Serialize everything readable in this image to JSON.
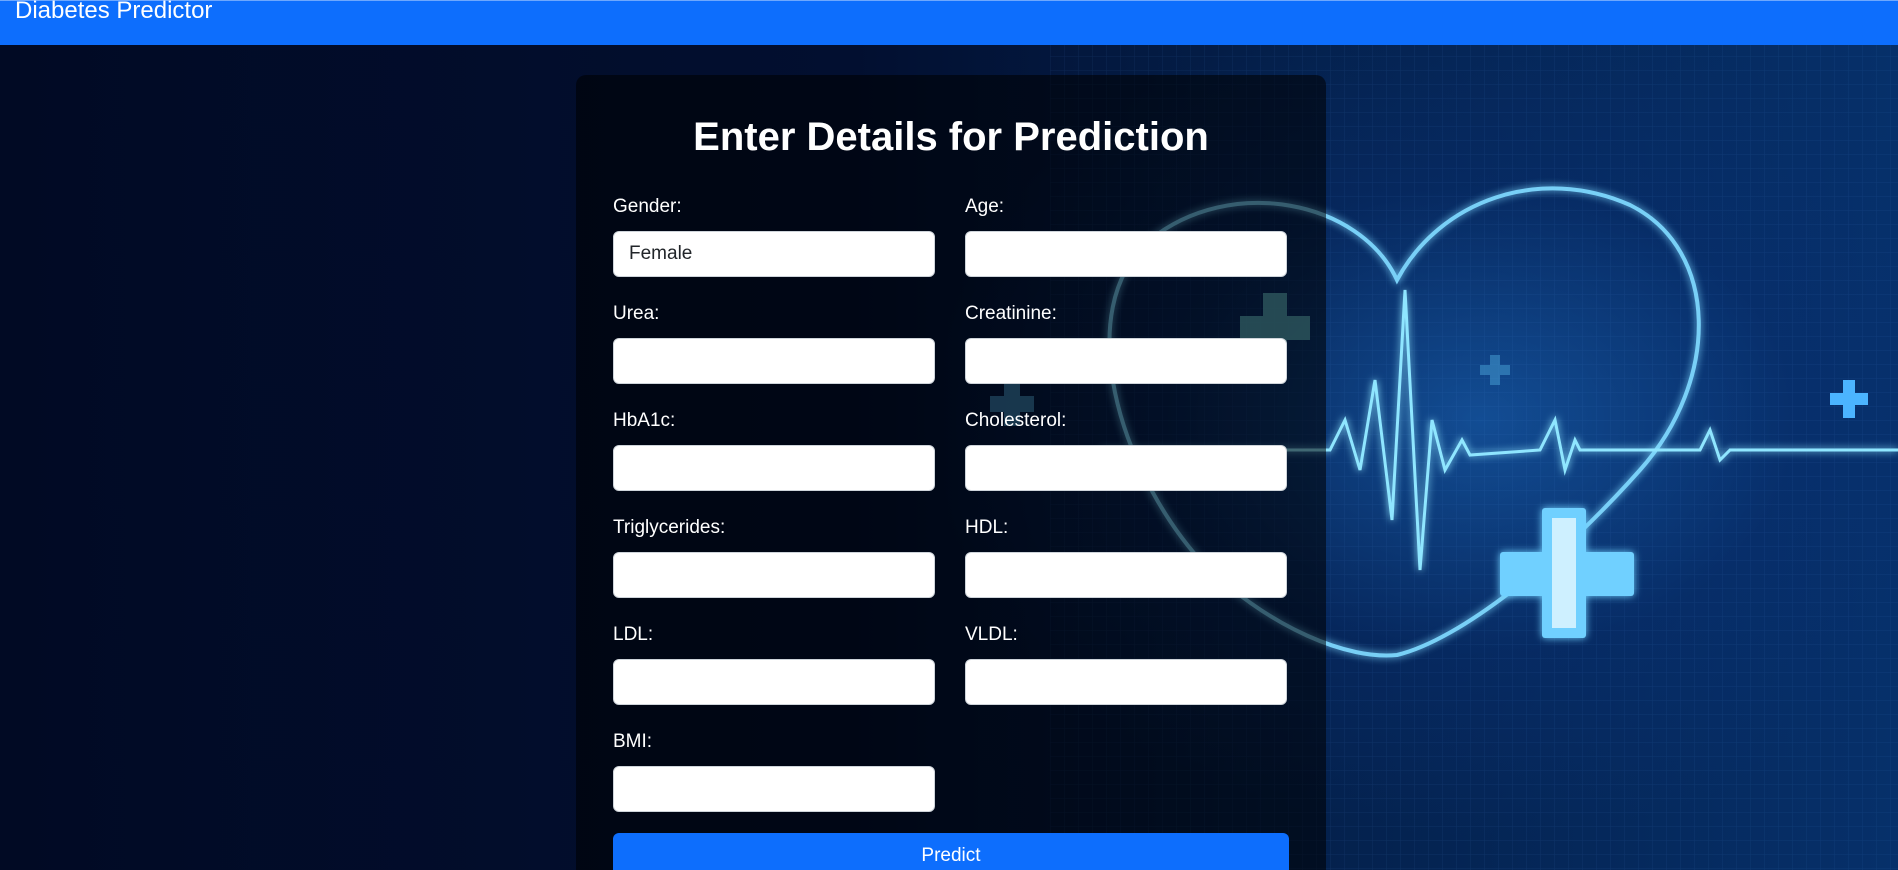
{
  "navbar": {
    "brand": "Diabetes Predictor"
  },
  "form": {
    "title": "Enter Details for Prediction",
    "fields": {
      "gender": {
        "label": "Gender:",
        "value": "Female"
      },
      "age": {
        "label": "Age:",
        "value": ""
      },
      "urea": {
        "label": "Urea:",
        "value": ""
      },
      "creatinine": {
        "label": "Creatinine:",
        "value": ""
      },
      "hba1c": {
        "label": "HbA1c:",
        "value": ""
      },
      "cholesterol": {
        "label": "Cholesterol:",
        "value": ""
      },
      "triglycerides": {
        "label": "Triglycerides:",
        "value": ""
      },
      "hdl": {
        "label": "HDL:",
        "value": ""
      },
      "ldl": {
        "label": "LDL:",
        "value": ""
      },
      "vldl": {
        "label": "VLDL:",
        "value": ""
      },
      "bmi": {
        "label": "BMI:",
        "value": ""
      }
    },
    "submit_label": "Predict"
  },
  "colors": {
    "navbar": "#0d6efd",
    "button": "#0d6efd",
    "background": "#010a24"
  },
  "background_image": {
    "icons": [
      "heart-icon",
      "heartbeat-line-icon",
      "medical-cross-icon"
    ]
  }
}
